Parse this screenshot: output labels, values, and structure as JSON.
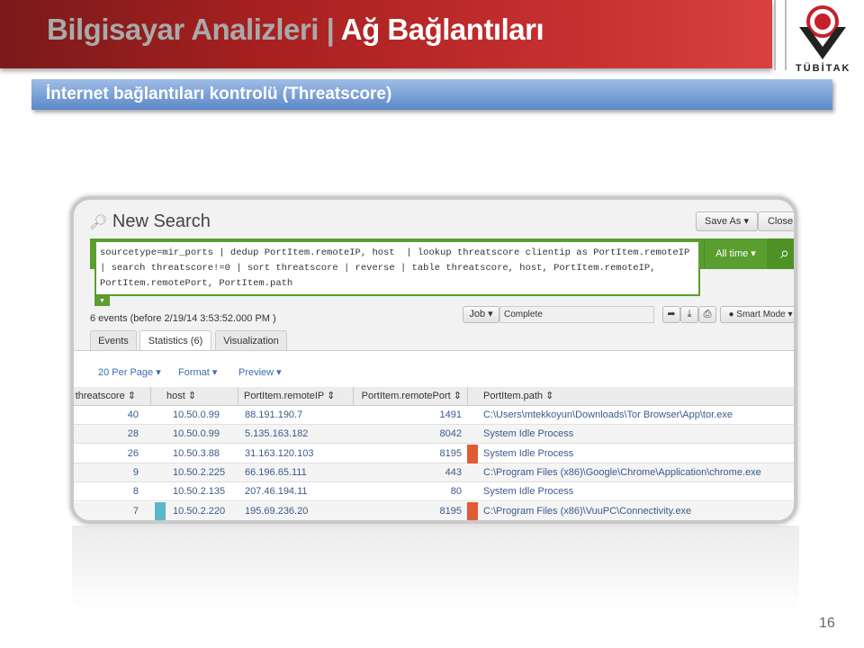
{
  "slide": {
    "title_part1": "Bilgisayar Analizleri",
    "separator": "|",
    "title_part2": "Ağ Bağlantıları",
    "subtitle": "İnternet bağlantıları kontrolü (Threatscore)",
    "logo_text": "TÜBİTAK",
    "page_number": "16"
  },
  "splunk": {
    "page_title": "New Search",
    "save_as": "Save As ▾",
    "close": "Close",
    "query": "sourcetype=mir_ports | dedup PortItem.remoteIP, host  | lookup threatscore clientip as PortItem.remoteIP | search threatscore!=0 | sort threatscore | reverse | table threatscore, host, PortItem.remoteIP, PortItem.remotePort, PortItem.path",
    "time_range": "All time ▾",
    "events_summary": "6 events (before 2/19/14 3:53:52.000 PM )",
    "job": "Job ▾",
    "job_status": "Complete",
    "smart_mode": "Smart Mode ▾",
    "tabs": [
      "Events",
      "Statistics (6)",
      "Visualization"
    ],
    "active_tab": "Statistics (6)",
    "toolbar": [
      "20 Per Page ▾",
      "Format ▾",
      "Preview ▾"
    ],
    "columns": [
      "threatscore",
      "host",
      "PortItem.remoteIP",
      "PortItem.remotePort",
      "PortItem.path"
    ],
    "rows": [
      [
        "40",
        "10.50.0.99",
        "88.191.190.7",
        "1491",
        "C:\\Users\\mtekkoyun\\Downloads\\Tor Browser\\App\\tor.exe"
      ],
      [
        "28",
        "10.50.0.99",
        "5.135.163.182",
        "8042",
        "System Idle Process"
      ],
      [
        "26",
        "10.50.3.88",
        "31.163.120.103",
        "8195",
        "System Idle Process"
      ],
      [
        "9",
        "10.50.2.225",
        "66.196.65.111",
        "443",
        "C:\\Program Files (x86)\\Google\\Chrome\\Application\\chrome.exe"
      ],
      [
        "8",
        "10.50.2.135",
        "207.46.194.11",
        "80",
        "System Idle Process"
      ],
      [
        "7",
        "10.50.2.220",
        "195.69.236.20",
        "8195",
        "C:\\Program Files (x86)\\VuuPC\\Connectivity.exe"
      ]
    ],
    "colors": {
      "search_green": "#5a9e2f",
      "marker_orange": "#e05a35",
      "marker_cyan": "#5bb8c8",
      "link_blue": "#3a5a8c"
    }
  }
}
